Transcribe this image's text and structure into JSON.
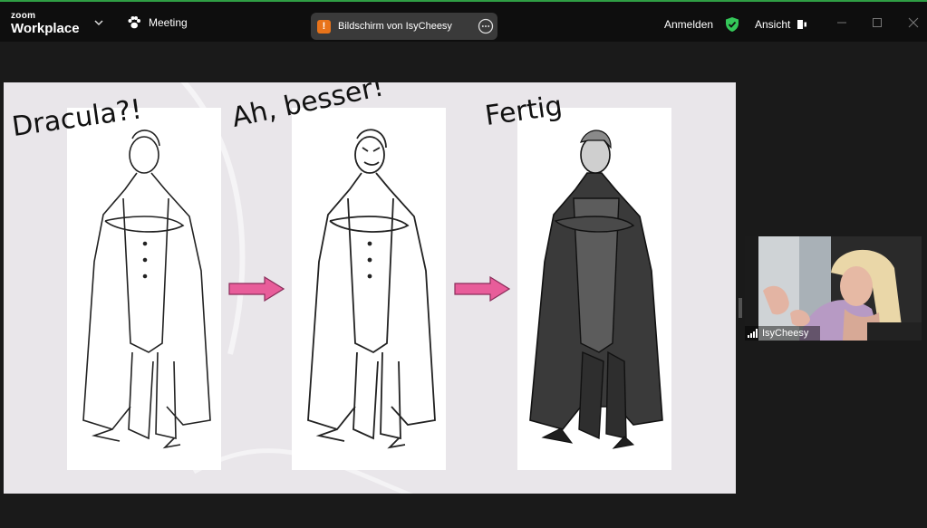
{
  "app": {
    "logo_line1": "zoom",
    "logo_line2": "Workplace",
    "meeting_label": "Meeting",
    "share_badge": "!",
    "share_text": "Bildschirm von IsyCheesy",
    "signin_label": "Anmelden",
    "view_label": "Ansicht"
  },
  "slide": {
    "captions": [
      "Dracula?!",
      "Ah, besser!",
      "Fertig"
    ]
  },
  "participant": {
    "name": "IsyCheesy"
  },
  "colors": {
    "arrow": "#e85d9a",
    "accent_green": "#2f9e44",
    "shield_green": "#34c759"
  }
}
